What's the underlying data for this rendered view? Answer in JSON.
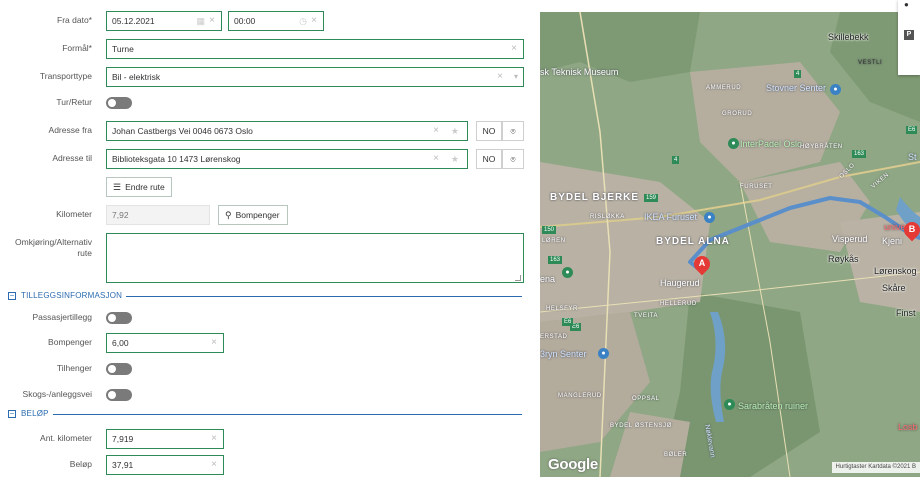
{
  "form": {
    "fra_dato": {
      "label": "Fra dato*",
      "date": "05.12.2021",
      "time": "00:00"
    },
    "formal": {
      "label": "Formål*",
      "value": "Turne"
    },
    "transporttype": {
      "label": "Transporttype",
      "value": "Bil - elektrisk"
    },
    "tur_retur": {
      "label": "Tur/Retur"
    },
    "adresse_fra": {
      "label": "Adresse fra",
      "value": "Johan Castbergs Vei 0046 0673 Oslo",
      "country": "NO"
    },
    "adresse_til": {
      "label": "Adresse til",
      "value": "Biblioteksgata 10 1473 Lørenskog",
      "country": "NO"
    },
    "endre_rute": {
      "label": "Endre rute"
    },
    "kilometer": {
      "label": "Kilometer",
      "value": "7,92",
      "bompenger_button": "Bompenger"
    },
    "omkjoring": {
      "label": "Omkjøring/Alternativ rute"
    },
    "tillegg_section": {
      "title": "TILLEGGSINFORMASJON",
      "toggle_icon": "minus-square-icon"
    },
    "passasjertillegg": {
      "label": "Passasjertillegg"
    },
    "bompenger": {
      "label": "Bompenger",
      "value": "6,00"
    },
    "tilhenger": {
      "label": "Tilhenger"
    },
    "skogs": {
      "label": "Skogs-/anleggsvei"
    },
    "belop_section": {
      "title": "BELØP",
      "toggle_icon": "minus-square-icon"
    },
    "ant_kilometer": {
      "label": "Ant. kilometer",
      "value": "7,919"
    },
    "belop": {
      "label": "Beløp",
      "value": "37,91"
    }
  },
  "map": {
    "labels": {
      "skillebekk": "Skillebekk",
      "vestli": "VESTLI",
      "teknisk": "sk Teknisk Museum",
      "ammerud": "AMMERUD",
      "stovner": "Stovner Senter",
      "grorud": "GRORUD",
      "interpadel": "InterPadel Oslo",
      "st": "St",
      "hoybraten": "HØYBRÅTEN",
      "furuset": "FURUSET",
      "bjerke": "BYDEL BJERKE",
      "risl": "RISLØKKA",
      "ikea": "IKEA Furuset",
      "loren": "LØREN",
      "alna": "BYDEL ALNA",
      "visperud": "Visperud",
      "kjeni": "Kjeni",
      "univ": "unive",
      "rovkas": "Røykås",
      "lorenskog": "Lørenskog",
      "skare": "Skåre",
      "finst": "Finst",
      "haugerud": "Haugerud",
      "ena": "ena",
      "hellerud": "HELLERUD",
      "helsfyr": "HELSFYR",
      "tveita": "TVEITA",
      "erstad": "ERSTAD",
      "bryn": "3ryn Senter",
      "manglerud": "MANGLERUD",
      "oppsal": "OPPSAL",
      "sarabraten": "Sarabråten ruiner",
      "ostensjo": "BYDEL ØSTENSJØ",
      "boler": "BØLER",
      "nokkelvann": "Nøklevann",
      "losby": "Losb",
      "oslo": "OSLO",
      "viken": "VIKEN"
    },
    "road_badges": [
      "4",
      "4",
      "163",
      "159",
      "150",
      "E6",
      "E6",
      "163",
      "E6"
    ],
    "markers": {
      "a": "A",
      "b": "B"
    },
    "google": "Google",
    "attribution": "Hurtigtaster   Kartdata ©2021   B",
    "colors": {
      "route": "#5b8fc9",
      "terrain": "#8fa784",
      "water": "#6fa0c8",
      "urban": "#b9b2a4",
      "marker": "#e53935",
      "poi_blue": "#3b82c4",
      "poi_green": "#2e8b57"
    }
  }
}
